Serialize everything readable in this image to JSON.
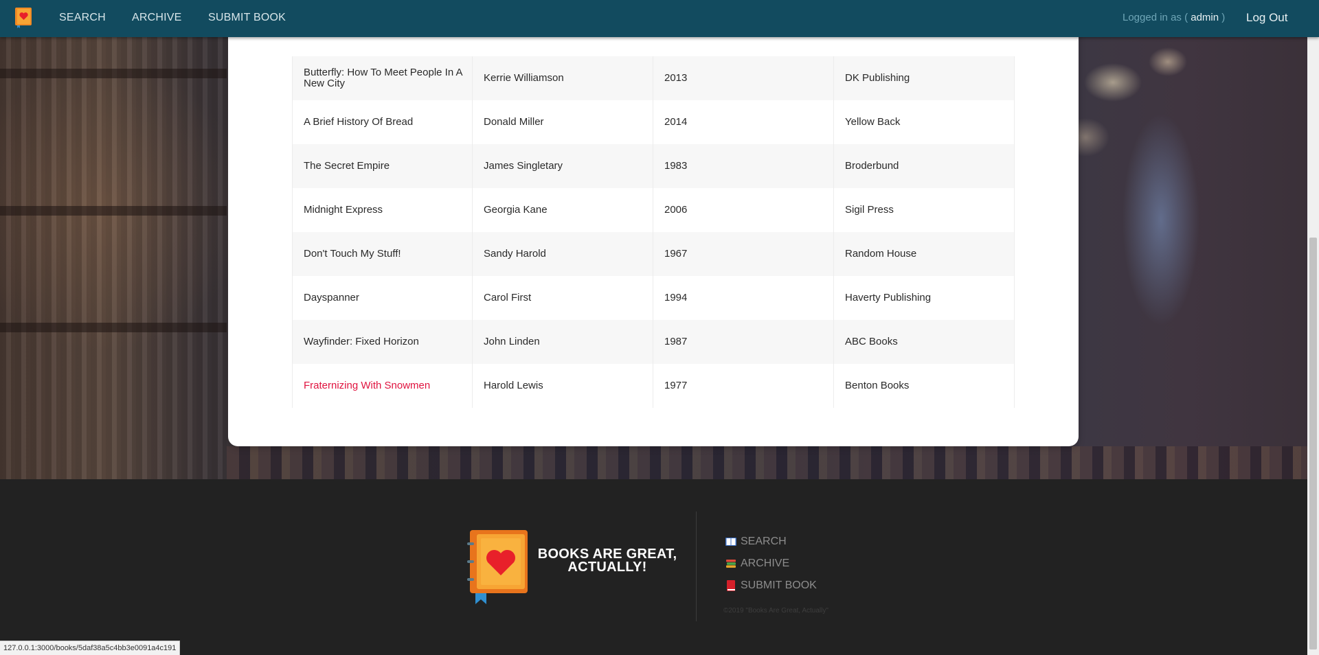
{
  "nav": {
    "logo_icon": "book-heart-icon",
    "links": [
      "SEARCH",
      "ARCHIVE",
      "SUBMIT BOOK"
    ],
    "login_prefix": "Logged in as (",
    "username": "admin",
    "login_suffix": ")",
    "logout": "Log Out",
    "bar_color": "#124b5f"
  },
  "table": {
    "rows": [
      {
        "title": "Butterfly: How To Meet People In A New City",
        "author": "Kerrie Williamson",
        "year": "2013",
        "publisher": "DK Publishing"
      },
      {
        "title": "A Brief History Of Bread",
        "author": "Donald Miller",
        "year": "2014",
        "publisher": "Yellow Back"
      },
      {
        "title": "The Secret Empire",
        "author": "James Singletary",
        "year": "1983",
        "publisher": "Broderbund"
      },
      {
        "title": "Midnight Express",
        "author": "Georgia Kane",
        "year": "2006",
        "publisher": "Sigil Press"
      },
      {
        "title": "Don't Touch My Stuff!",
        "author": "Sandy Harold",
        "year": "1967",
        "publisher": "Random House"
      },
      {
        "title": "Dayspanner",
        "author": "Carol First",
        "year": "1994",
        "publisher": "Haverty Publishing"
      },
      {
        "title": "Wayfinder: Fixed Horizon",
        "author": "John Linden",
        "year": "1987",
        "publisher": "ABC Books"
      },
      {
        "title": "Fraternizing With Snowmen",
        "author": "Harold Lewis",
        "year": "1977",
        "publisher": "Benton Books"
      }
    ],
    "hovered_link_color": "#e0133f"
  },
  "footer": {
    "tagline": "BOOKS ARE GREAT, ACTUALLY!",
    "links": [
      {
        "label": "SEARCH",
        "icon": "open-book-icon"
      },
      {
        "label": "ARCHIVE",
        "icon": "book-stack-icon"
      },
      {
        "label": "SUBMIT BOOK",
        "icon": "red-book-icon"
      }
    ],
    "copyright": "©2019 \"Books Are Great, Actually\""
  },
  "status_url": "127.0.0.1:3000/books/5daf38a5c4bb3e0091a4c191"
}
